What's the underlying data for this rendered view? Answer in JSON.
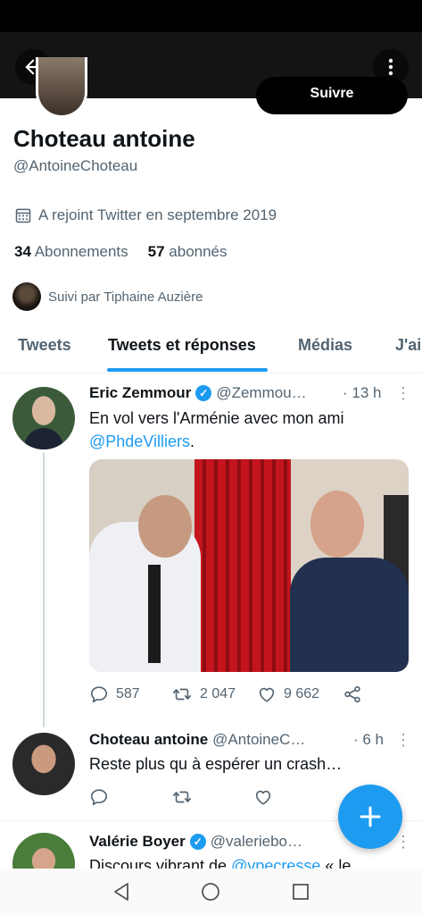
{
  "profile": {
    "follow_label": "Suivre",
    "name": "Choteau antoine",
    "handle": "@AntoineChoteau",
    "joined": "A rejoint Twitter en septembre 2019",
    "following_count": "34",
    "following_label": "Abonnements",
    "followers_count": "57",
    "followers_label": "abonnés",
    "followed_by": "Suivi par Tiphaine Auzière"
  },
  "tabs": [
    {
      "label": "Tweets"
    },
    {
      "label": "Tweets et réponses"
    },
    {
      "label": "Médias"
    },
    {
      "label": "J'ai"
    }
  ],
  "tweets": [
    {
      "name": "Eric Zemmour",
      "handle": "@Zemmou…",
      "time": "· 13 h",
      "text": "En vol vers l'Arménie avec mon ami",
      "mention": "@PhdeVilliers",
      "after_mention": ".",
      "replies": "587",
      "retweets": "2 047",
      "likes": "9 662"
    },
    {
      "name": "Choteau antoine",
      "handle": "@AntoineC…",
      "time": "· 6 h",
      "text": "Reste plus qu à espérer un crash…"
    },
    {
      "name": "Valérie Boyer",
      "handle": "@valeriebo…",
      "text": "Discours vibrant de",
      "mention": "@vpecresse",
      "after_mention": " « le"
    }
  ],
  "colors": {
    "accent": "#1d9bf0",
    "text": "#0f1419",
    "muted": "#536471"
  }
}
